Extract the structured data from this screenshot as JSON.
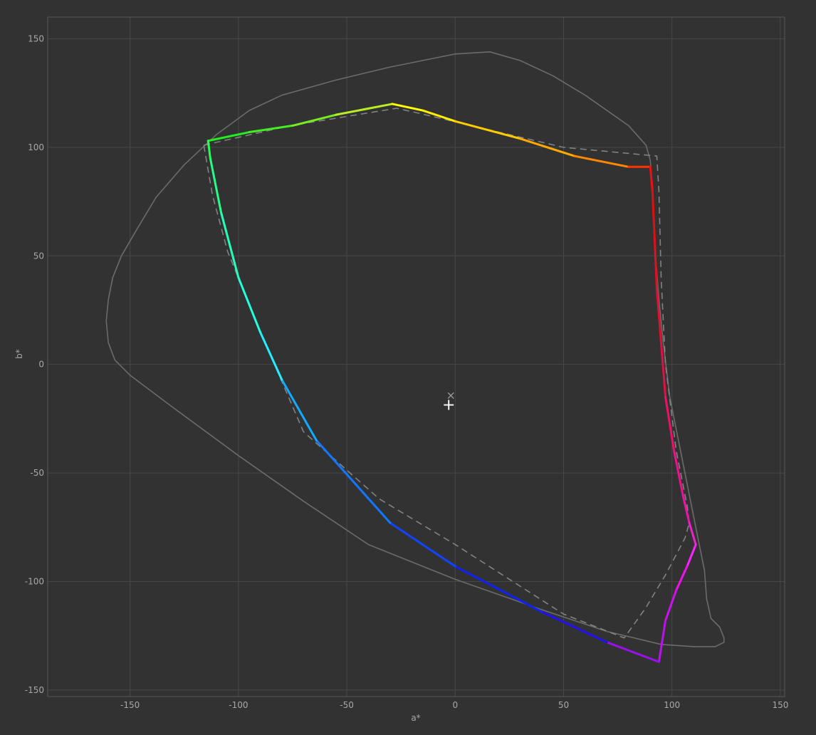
{
  "chart_data": {
    "type": "line",
    "title": "",
    "xlabel": "a*",
    "ylabel": "b*",
    "xlim": [
      -188,
      152
    ],
    "ylim": [
      -153,
      160
    ],
    "xticks": [
      -150,
      -100,
      -50,
      0,
      50,
      100,
      150
    ],
    "yticks": [
      150,
      100,
      50,
      0,
      -50,
      -100,
      -150
    ],
    "grid": true,
    "series": [
      {
        "style": "solid-gray",
        "color": "#6b6b6b",
        "points": [
          [
            -161,
            20
          ],
          [
            -160,
            30
          ],
          [
            -158,
            40
          ],
          [
            -154,
            50
          ],
          [
            -147,
            62
          ],
          [
            -138,
            77
          ],
          [
            -125,
            92
          ],
          [
            -110,
            106
          ],
          [
            -95,
            117
          ],
          [
            -80,
            124
          ],
          [
            -55,
            131
          ],
          [
            -30,
            137
          ],
          [
            0,
            143
          ],
          [
            16,
            144
          ],
          [
            30,
            140
          ],
          [
            45,
            133
          ],
          [
            60,
            124
          ],
          [
            80,
            110
          ],
          [
            88,
            101
          ],
          [
            90,
            94
          ],
          [
            91,
            80
          ],
          [
            92,
            55
          ],
          [
            94,
            30
          ],
          [
            96,
            10
          ],
          [
            99,
            -15
          ],
          [
            103,
            -35
          ],
          [
            107,
            -55
          ],
          [
            110,
            -70
          ],
          [
            115,
            -95
          ],
          [
            116,
            -108
          ],
          [
            118,
            -117
          ],
          [
            122,
            -121
          ],
          [
            124,
            -126
          ],
          [
            124,
            -128
          ],
          [
            120,
            -130
          ],
          [
            110,
            -130
          ],
          [
            95,
            -129
          ],
          [
            70,
            -123
          ],
          [
            40,
            -113
          ],
          [
            0,
            -99
          ],
          [
            -40,
            -83
          ],
          [
            -70,
            -63
          ],
          [
            -100,
            -42
          ],
          [
            -130,
            -20
          ],
          [
            -150,
            -5
          ],
          [
            -157,
            2
          ],
          [
            -160,
            10
          ],
          [
            -161,
            20
          ]
        ]
      },
      {
        "style": "dashed-gray",
        "color": "#828282",
        "points": [
          [
            -116,
            101
          ],
          [
            -76,
            110
          ],
          [
            -27,
            118
          ],
          [
            -18,
            116
          ],
          [
            50,
            100
          ],
          [
            93,
            96
          ],
          [
            94,
            80
          ],
          [
            95,
            40
          ],
          [
            97,
            0
          ],
          [
            102,
            -40
          ],
          [
            107,
            -65
          ],
          [
            108,
            -73
          ],
          [
            106,
            -80
          ],
          [
            97,
            -97
          ],
          [
            88,
            -112
          ],
          [
            78,
            -126
          ],
          [
            50,
            -115
          ],
          [
            0,
            -83
          ],
          [
            -35,
            -62
          ],
          [
            -70,
            -31
          ],
          [
            -89,
            13
          ],
          [
            -105,
            52
          ],
          [
            -112,
            78
          ],
          [
            -116,
            101
          ]
        ]
      },
      {
        "style": "gradient",
        "gamut": true,
        "points": [
          [
            -114,
            103
          ],
          [
            -95,
            107
          ],
          [
            -75,
            110
          ],
          [
            -55,
            115
          ],
          [
            -29,
            120
          ],
          [
            -15,
            117
          ],
          [
            0,
            112
          ],
          [
            30,
            104
          ],
          [
            55,
            96
          ],
          [
            80,
            91
          ],
          [
            90,
            91
          ],
          [
            91,
            80
          ],
          [
            92,
            58
          ],
          [
            93,
            35
          ],
          [
            95,
            10
          ],
          [
            97,
            -15
          ],
          [
            101,
            -40
          ],
          [
            105,
            -60
          ],
          [
            108,
            -73
          ],
          [
            111,
            -83
          ],
          [
            107,
            -93
          ],
          [
            102,
            -104
          ],
          [
            97,
            -118
          ],
          [
            94,
            -137
          ],
          [
            70,
            -128
          ],
          [
            40,
            -114
          ],
          [
            0,
            -93
          ],
          [
            -30,
            -73
          ],
          [
            -64,
            -35
          ],
          [
            -80,
            -7
          ],
          [
            -90,
            15
          ],
          [
            -100,
            40
          ],
          [
            -108,
            70
          ],
          [
            -113,
            95
          ],
          [
            -114,
            103
          ]
        ],
        "colors": [
          "#22ee22",
          "#44ee22",
          "#77ee22",
          "#bbee22",
          "#ffff00",
          "#ffee00",
          "#ffcc00",
          "#ffaa00",
          "#ff8800",
          "#ff3300",
          "#ee1111",
          "#dd1111",
          "#dd1122",
          "#dd1133",
          "#dd1144",
          "#ee1166",
          "#ee1188",
          "#ee11aa",
          "#ee22cc",
          "#ff22ff",
          "#ee11ee",
          "#cc11ee",
          "#bb11ee",
          "#9911ee",
          "#2211ee",
          "#1122ee",
          "#1144ff",
          "#1177ff",
          "#11aaff",
          "#22eeff",
          "#22ffdd",
          "#22ffbb",
          "#22ff88",
          "#22ff55",
          "#22ff22"
        ]
      }
    ],
    "markers": [
      {
        "name": "cross-x-marker",
        "x": -2,
        "y": -14,
        "symbol": "×",
        "color": "#9a9a9a"
      },
      {
        "name": "plus-marker",
        "x": -3,
        "y": -19,
        "symbol": "+",
        "color": "#ffffff"
      }
    ]
  }
}
